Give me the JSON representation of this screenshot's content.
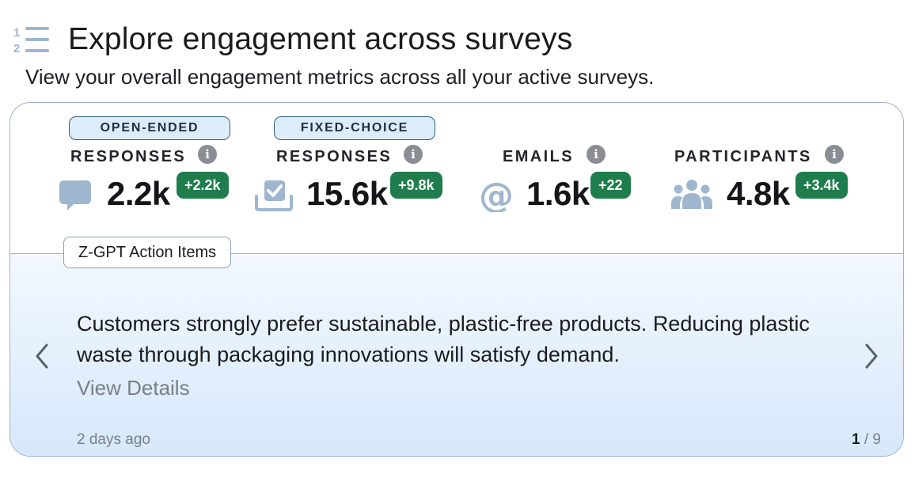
{
  "header": {
    "icon": "numbered-list-icon",
    "title": "Explore engagement across surveys",
    "subtitle": "View your overall engagement metrics across all your active surveys."
  },
  "metrics": [
    {
      "pill": "OPEN-ENDED",
      "label": "RESPONSES",
      "icon": "chat-bubble-icon",
      "value": "2.2k",
      "delta": "+2.2k"
    },
    {
      "pill": "FIXED-CHOICE",
      "label": "RESPONSES",
      "icon": "checkbox-tray-icon",
      "value": "15.6k",
      "delta": "+9.8k"
    },
    {
      "label": "EMAILS",
      "icon": "at-sign-icon",
      "value": "1.6k",
      "delta": "+22"
    },
    {
      "label": "PARTICIPANTS",
      "icon": "people-group-icon",
      "value": "4.8k",
      "delta": "+3.4k"
    }
  ],
  "action_items": {
    "tag": "Z-GPT Action Items",
    "text": "Customers strongly prefer sustainable, plastic-free products. Reducing plastic waste through packaging innovations will satisfy demand.",
    "link": "View Details",
    "timestamp": "2 days ago",
    "page_current": "1",
    "page_total": "/ 9"
  },
  "colors": {
    "delta_badge": "#1f7d4d",
    "pill_bg": "#dcecf8",
    "icon_blue": "#9fb6cf",
    "card_border": "#9fb3c8"
  }
}
